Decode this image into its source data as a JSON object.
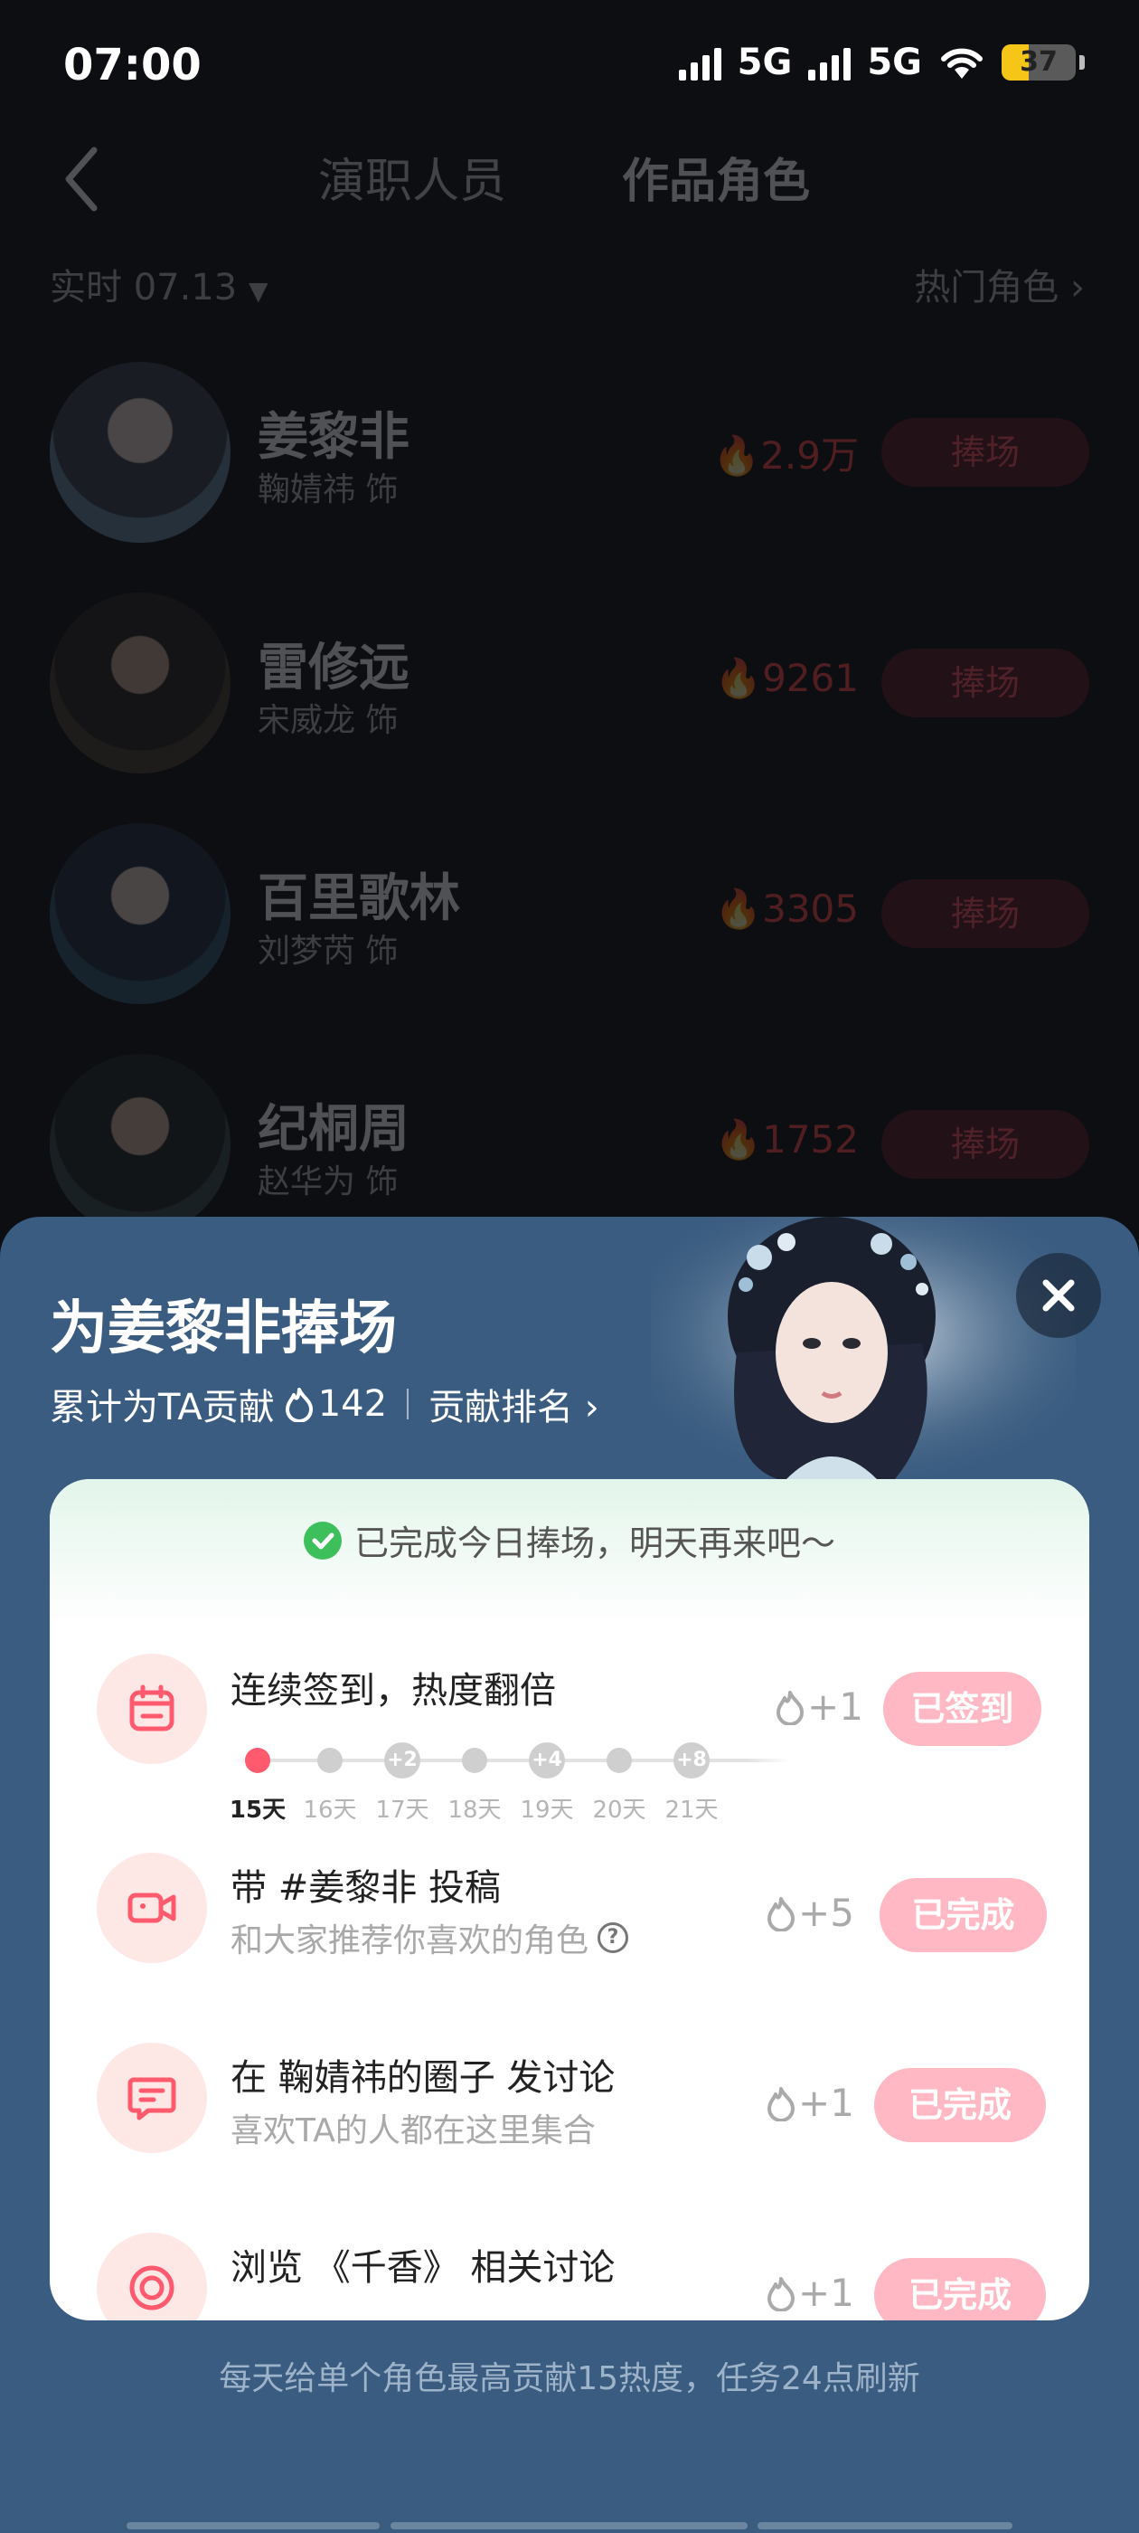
{
  "status_bar": {
    "time": "07:00",
    "network_1": "5G",
    "network_2": "5G",
    "battery": "37",
    "battery_level": 0.37
  },
  "nav": {
    "tabs": [
      "演职人员",
      "作品角色"
    ],
    "active_tab": 1
  },
  "filter": {
    "date": "实时 07.13",
    "hot_roles": "热门角色"
  },
  "roles": [
    {
      "name": "姜黎非",
      "actor": "鞠婧祎 饰",
      "heat": "2.9万",
      "action": "捧场"
    },
    {
      "name": "雷修远",
      "actor": "宋威龙 饰",
      "heat": "9261",
      "action": "捧场"
    },
    {
      "name": "百里歌林",
      "actor": "刘梦芮 饰",
      "heat": "3305",
      "action": "捧场"
    },
    {
      "name": "纪桐周",
      "actor": "赵华为 饰",
      "heat": "1752",
      "action": "捧场"
    }
  ],
  "sheet": {
    "title": "为姜黎非捧场",
    "contrib_prefix": "累计为TA贡献",
    "contrib_value": "142",
    "rank_link": "贡献排名",
    "done_message": "已完成今日捧场，明天再来吧～",
    "tasks": [
      {
        "title": "连续签到，热度翻倍",
        "reward": "+1",
        "button": "已签到",
        "streak": [
          {
            "bonus": "",
            "day": "15天"
          },
          {
            "bonus": "",
            "day": "16天"
          },
          {
            "bonus": "+2",
            "day": "17天"
          },
          {
            "bonus": "",
            "day": "18天"
          },
          {
            "bonus": "+4",
            "day": "19天"
          },
          {
            "bonus": "",
            "day": "20天"
          },
          {
            "bonus": "+8",
            "day": "21天"
          }
        ]
      },
      {
        "title": "带 #姜黎非 投稿",
        "desc": "和大家推荐你喜欢的角色",
        "reward": "+5",
        "button": "已完成"
      },
      {
        "title": "在 鞠婧祎的圈子 发讨论",
        "desc": "喜欢TA的人都在这里集合",
        "reward": "+1",
        "button": "已完成"
      },
      {
        "title": "浏览 《千香》 相关讨论",
        "reward": "+1",
        "button": "已完成"
      }
    ],
    "footer_note": "每天给单个角色最高贡献15热度，任务24点刷新"
  },
  "colors": {
    "sheet_bg": "#3a5c80",
    "accent_red": "#ff5a6e",
    "button_pink": "#ffb8c4",
    "check_green": "#3dbf5c"
  }
}
